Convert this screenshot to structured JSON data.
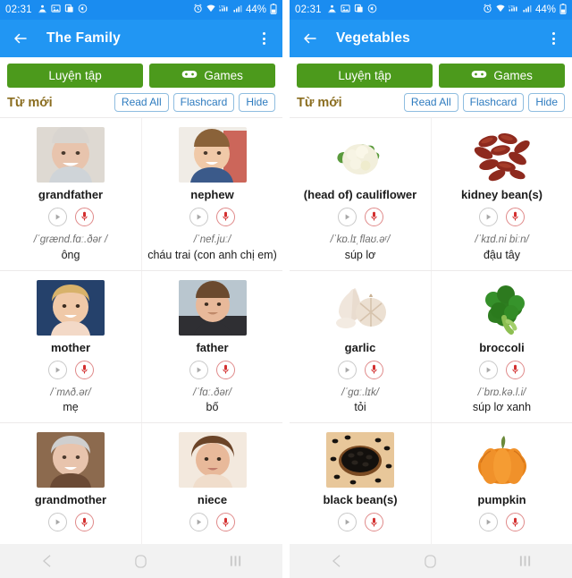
{
  "colors": {
    "status_bar": "#1a8cf0",
    "app_bar": "#2196f3",
    "green_button": "#4c9a1c",
    "pill_border": "#8fbde0",
    "pill_text": "#2e7bbf",
    "section_title": "#8a6d1f",
    "mic_red": "#d32f2f",
    "nav_bar": "#f2f2f2"
  },
  "status_bar": {
    "time": "02:31",
    "battery_percent": "44%",
    "left_icons": [
      "contacts-sync-icon",
      "image-icon",
      "copy-icon",
      "volume-icon"
    ],
    "right_icons": [
      "alarm-icon",
      "wifi-icon",
      "lte-signal-icon",
      "signal-bars-icon",
      "battery-icon"
    ]
  },
  "screens": [
    {
      "app_bar": {
        "back_icon": "back-arrow-icon",
        "title": "The Family",
        "overflow_icon": "kebab-menu-icon"
      },
      "actions": {
        "practice_label": "Luyện tập",
        "games_label": "Games",
        "games_icon": "gamepad-icon"
      },
      "section": {
        "title": "Từ mới",
        "pills": [
          "Read All",
          "Flashcard",
          "Hide"
        ]
      },
      "words": [
        {
          "word": "grandfather",
          "ipa": "/ˈgrænd.fɑː.ðər /",
          "translation": "ông",
          "image": "portrait-elderly-man",
          "play_icon": "play-icon",
          "mic_icon": "microphone-icon"
        },
        {
          "word": "nephew",
          "ipa": "/ˈnef.juː/",
          "translation": "cháu trai (con anh chị em)",
          "image": "portrait-boy",
          "play_icon": "play-icon",
          "mic_icon": "microphone-icon"
        },
        {
          "word": "mother",
          "ipa": "/ˈmʌð.ər/",
          "translation": "mẹ",
          "image": "portrait-woman",
          "play_icon": "play-icon",
          "mic_icon": "microphone-icon"
        },
        {
          "word": "father",
          "ipa": "/ˈfɑː.ðər/",
          "translation": "bố",
          "image": "portrait-man",
          "play_icon": "play-icon",
          "mic_icon": "microphone-icon"
        },
        {
          "word": "grandmother",
          "ipa": "",
          "translation": "",
          "image": "portrait-elderly-woman",
          "play_icon": "play-icon",
          "mic_icon": "microphone-icon"
        },
        {
          "word": "niece",
          "ipa": "",
          "translation": "",
          "image": "portrait-girl",
          "play_icon": "play-icon",
          "mic_icon": "microphone-icon"
        }
      ]
    },
    {
      "app_bar": {
        "back_icon": "back-arrow-icon",
        "title": "Vegetables",
        "overflow_icon": "kebab-menu-icon"
      },
      "actions": {
        "practice_label": "Luyện tập",
        "games_label": "Games",
        "games_icon": "gamepad-icon"
      },
      "section": {
        "title": "Từ mới",
        "pills": [
          "Read All",
          "Flashcard",
          "Hide"
        ]
      },
      "words": [
        {
          "word": "(head of) cauliflower",
          "ipa": "/ˈkɒ.lɪˌflaʊ.əʳ/",
          "translation": "súp lơ",
          "image": "cauliflower",
          "play_icon": "play-icon",
          "mic_icon": "microphone-icon"
        },
        {
          "word": "kidney bean(s)",
          "ipa": "/ˈkɪd.ni biːn/",
          "translation": "đậu tây",
          "image": "kidney-beans",
          "play_icon": "play-icon",
          "mic_icon": "microphone-icon"
        },
        {
          "word": "garlic",
          "ipa": "/ˈgɑː.lɪk/",
          "translation": "tỏi",
          "image": "garlic",
          "play_icon": "play-icon",
          "mic_icon": "microphone-icon"
        },
        {
          "word": "broccoli",
          "ipa": "/ˈbrɒ.kə.l.i/",
          "translation": "súp lơ xanh",
          "image": "broccoli",
          "play_icon": "play-icon",
          "mic_icon": "microphone-icon"
        },
        {
          "word": "black bean(s)",
          "ipa": "",
          "translation": "",
          "image": "black-beans",
          "play_icon": "play-icon",
          "mic_icon": "microphone-icon"
        },
        {
          "word": "pumpkin",
          "ipa": "",
          "translation": "",
          "image": "pumpkin",
          "play_icon": "play-icon",
          "mic_icon": "microphone-icon"
        }
      ]
    }
  ],
  "nav_bar": {
    "buttons": [
      "back-nav-icon",
      "home-nav-icon",
      "recents-nav-icon"
    ]
  }
}
